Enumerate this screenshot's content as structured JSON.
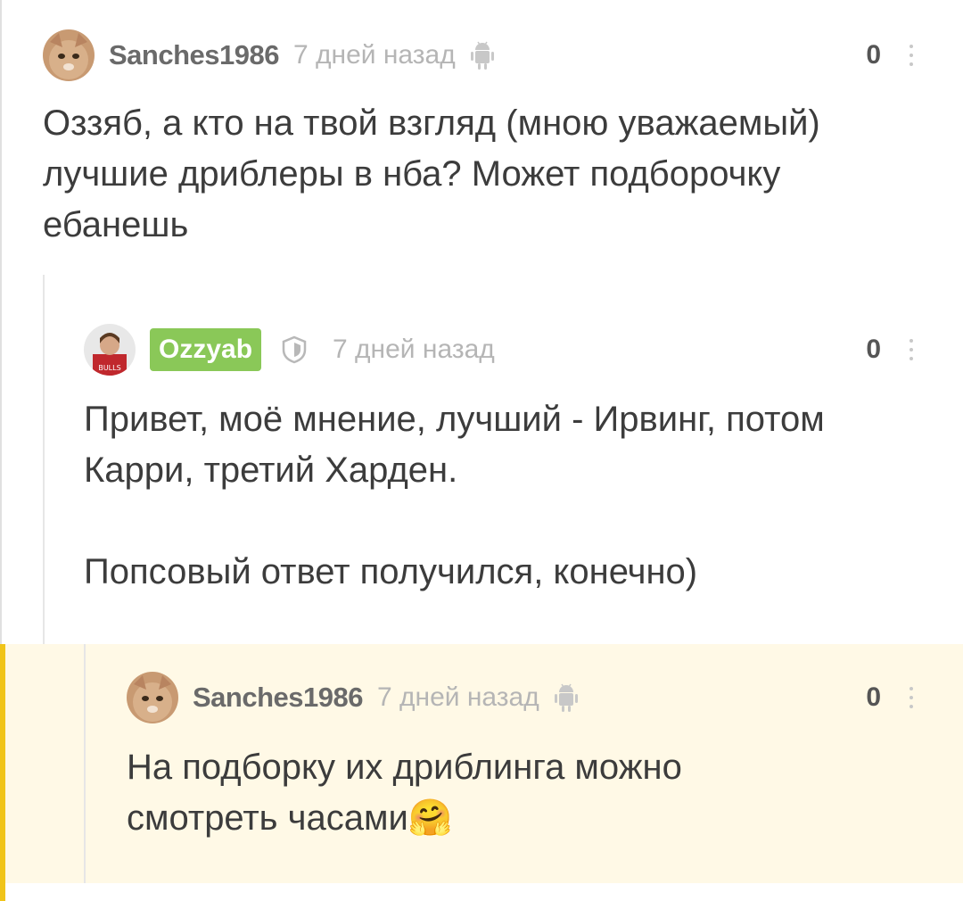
{
  "comments": [
    {
      "username": "Sanches1986",
      "time": "7 дней назад",
      "rating": "0",
      "platform_icon": "android-icon",
      "text": "Оззяб, а кто на твой взгляд (мною уважаемый)\nлучшие дриблеры в нба? Может подборочку\nебанешь"
    },
    {
      "username": "Ozzyab",
      "badge_color": "#8ac858",
      "shield_icon": "shield-icon",
      "time": "7 дней назад",
      "rating": "0",
      "text": "Привет, моё мнение, лучший - Ирвинг, потом\nКарри, третий Харден.\n\nПопсовый ответ получился, конечно)"
    },
    {
      "username": "Sanches1986",
      "time": "7 дней назад",
      "rating": "0",
      "platform_icon": "android-icon",
      "text": "На подборку их дриблинга можно\nсмотреть часами",
      "emoji": "🤗"
    }
  ],
  "colors": {
    "accent": "#f0c419",
    "highlight_bg": "#fff9e6",
    "meta_text": "#b5b5b5"
  }
}
